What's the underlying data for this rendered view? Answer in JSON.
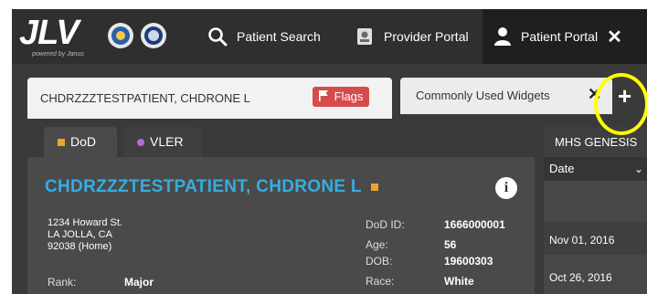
{
  "app": {
    "logo_text": "JLV",
    "logo_sub": "powered by Janus"
  },
  "nav": {
    "patient_search": "Patient Search",
    "provider_portal": "Provider Portal",
    "patient_portal": "Patient Portal",
    "close_glyph": "✕"
  },
  "tabs": {
    "patient_tab_label": "CHDRZZZTESTPATIENT, CHDRONE L",
    "flags_label": "Flags",
    "widgets_tab_label": "Commonly Used Widgets",
    "widgets_close_glyph": "✕",
    "add_glyph": "+"
  },
  "subtabs": [
    {
      "label": "DoD"
    },
    {
      "label": "VLER"
    }
  ],
  "patient": {
    "name": "CHDRZZZTESTPATIENT, CHDRONE L",
    "info_glyph": "i",
    "address": [
      "1234 Howard St.",
      "LA JOLLA, CA",
      "92038 (Home)"
    ],
    "rank_label": "Rank:",
    "rank_value": "Major",
    "dod_id_label": "DoD ID:",
    "dod_id_value": "1666000001",
    "age_label": "Age:",
    "age_value": "56",
    "dob_label": "DOB:",
    "dob_value": "19600303",
    "race_label": "Race:",
    "race_value": "White"
  },
  "mhs": {
    "title": "MHS GENESIS",
    "column": "Date",
    "rows": [
      "Nov 01, 2016",
      "Oct 26, 2016"
    ]
  },
  "colors": {
    "topbar": "#2f2f2f",
    "accent_name": "#35aee1",
    "flag": "#d64b4b",
    "dod_marker": "#f1a22b",
    "vler_marker": "#b86ad8",
    "highlight": "#ffff00"
  },
  "icons": {
    "search": "search-icon",
    "provider": "provider-portal-icon",
    "patient": "user-icon",
    "flag": "flag-icon",
    "seal_va": "va-seal-icon",
    "seal_dod": "dod-seal-icon"
  }
}
